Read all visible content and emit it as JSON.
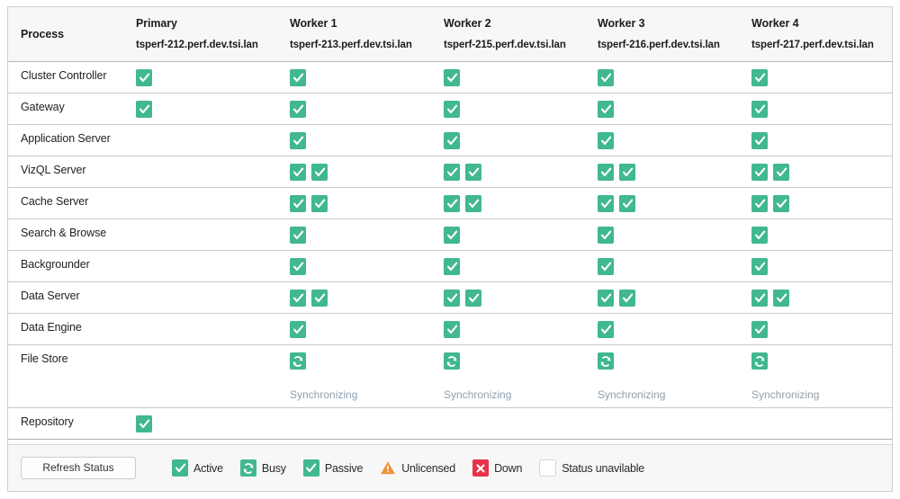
{
  "table": {
    "columns": [
      {
        "id": "process",
        "role": "Process",
        "host": ""
      },
      {
        "id": "primary",
        "role": "Primary",
        "host": "tsperf-212.perf.dev.tsi.lan"
      },
      {
        "id": "worker1",
        "role": "Worker 1",
        "host": "tsperf-213.perf.dev.tsi.lan"
      },
      {
        "id": "worker2",
        "role": "Worker 2",
        "host": "tsperf-215.perf.dev.tsi.lan"
      },
      {
        "id": "worker3",
        "role": "Worker 3",
        "host": "tsperf-216.perf.dev.tsi.lan"
      },
      {
        "id": "worker4",
        "role": "Worker 4",
        "host": "tsperf-217.perf.dev.tsi.lan"
      }
    ],
    "rows": [
      {
        "process": "Cluster Controller",
        "cells": [
          {
            "statuses": [
              "active"
            ],
            "label": ""
          },
          {
            "statuses": [
              "active"
            ],
            "label": ""
          },
          {
            "statuses": [
              "active"
            ],
            "label": ""
          },
          {
            "statuses": [
              "active"
            ],
            "label": ""
          },
          {
            "statuses": [
              "active"
            ],
            "label": ""
          }
        ]
      },
      {
        "process": "Gateway",
        "cells": [
          {
            "statuses": [
              "active"
            ],
            "label": ""
          },
          {
            "statuses": [
              "active"
            ],
            "label": ""
          },
          {
            "statuses": [
              "active"
            ],
            "label": ""
          },
          {
            "statuses": [
              "active"
            ],
            "label": ""
          },
          {
            "statuses": [
              "active"
            ],
            "label": ""
          }
        ]
      },
      {
        "process": "Application Server",
        "cells": [
          {
            "statuses": [],
            "label": ""
          },
          {
            "statuses": [
              "active"
            ],
            "label": ""
          },
          {
            "statuses": [
              "active"
            ],
            "label": ""
          },
          {
            "statuses": [
              "active"
            ],
            "label": ""
          },
          {
            "statuses": [
              "active"
            ],
            "label": ""
          }
        ]
      },
      {
        "process": "VizQL Server",
        "cells": [
          {
            "statuses": [],
            "label": ""
          },
          {
            "statuses": [
              "active",
              "active"
            ],
            "label": ""
          },
          {
            "statuses": [
              "active",
              "active"
            ],
            "label": ""
          },
          {
            "statuses": [
              "active",
              "active"
            ],
            "label": ""
          },
          {
            "statuses": [
              "active",
              "active"
            ],
            "label": ""
          }
        ]
      },
      {
        "process": "Cache Server",
        "cells": [
          {
            "statuses": [],
            "label": ""
          },
          {
            "statuses": [
              "active",
              "active"
            ],
            "label": ""
          },
          {
            "statuses": [
              "active",
              "active"
            ],
            "label": ""
          },
          {
            "statuses": [
              "active",
              "active"
            ],
            "label": ""
          },
          {
            "statuses": [
              "active",
              "active"
            ],
            "label": ""
          }
        ]
      },
      {
        "process": "Search & Browse",
        "cells": [
          {
            "statuses": [],
            "label": ""
          },
          {
            "statuses": [
              "active"
            ],
            "label": ""
          },
          {
            "statuses": [
              "active"
            ],
            "label": ""
          },
          {
            "statuses": [
              "active"
            ],
            "label": ""
          },
          {
            "statuses": [
              "active"
            ],
            "label": ""
          }
        ]
      },
      {
        "process": "Backgrounder",
        "cells": [
          {
            "statuses": [],
            "label": ""
          },
          {
            "statuses": [
              "active"
            ],
            "label": ""
          },
          {
            "statuses": [
              "active"
            ],
            "label": ""
          },
          {
            "statuses": [
              "active"
            ],
            "label": ""
          },
          {
            "statuses": [
              "active"
            ],
            "label": ""
          }
        ]
      },
      {
        "process": "Data Server",
        "cells": [
          {
            "statuses": [],
            "label": ""
          },
          {
            "statuses": [
              "active",
              "active"
            ],
            "label": ""
          },
          {
            "statuses": [
              "active",
              "active"
            ],
            "label": ""
          },
          {
            "statuses": [
              "active",
              "active"
            ],
            "label": ""
          },
          {
            "statuses": [
              "active",
              "active"
            ],
            "label": ""
          }
        ]
      },
      {
        "process": "Data Engine",
        "cells": [
          {
            "statuses": [],
            "label": ""
          },
          {
            "statuses": [
              "active"
            ],
            "label": ""
          },
          {
            "statuses": [
              "active"
            ],
            "label": ""
          },
          {
            "statuses": [
              "active"
            ],
            "label": ""
          },
          {
            "statuses": [
              "active"
            ],
            "label": ""
          }
        ]
      },
      {
        "process": "File Store",
        "tall": true,
        "cells": [
          {
            "statuses": [],
            "label": ""
          },
          {
            "statuses": [
              "busy"
            ],
            "label": "Synchronizing"
          },
          {
            "statuses": [
              "busy"
            ],
            "label": "Synchronizing"
          },
          {
            "statuses": [
              "busy"
            ],
            "label": "Synchronizing"
          },
          {
            "statuses": [
              "busy"
            ],
            "label": "Synchronizing"
          }
        ]
      },
      {
        "process": "Repository",
        "last": true,
        "cells": [
          {
            "statuses": [
              "active"
            ],
            "label": ""
          },
          {
            "statuses": [],
            "label": ""
          },
          {
            "statuses": [],
            "label": ""
          },
          {
            "statuses": [],
            "label": ""
          },
          {
            "statuses": [],
            "label": ""
          }
        ]
      }
    ]
  },
  "footer": {
    "refresh_label": "Refresh Status",
    "legend": [
      {
        "status": "active",
        "label": "Active"
      },
      {
        "status": "busy",
        "label": "Busy"
      },
      {
        "status": "passive",
        "label": "Passive"
      },
      {
        "status": "unlicensed",
        "label": "Unlicensed"
      },
      {
        "status": "down",
        "label": "Down"
      },
      {
        "status": "unavailable",
        "label": "Status unavilable"
      }
    ]
  },
  "colors": {
    "green": "#41b88e",
    "red": "#e8334a",
    "orange": "#f0933b",
    "sync_text": "#8fa0ae",
    "header_bg": "#f7f7f7"
  }
}
